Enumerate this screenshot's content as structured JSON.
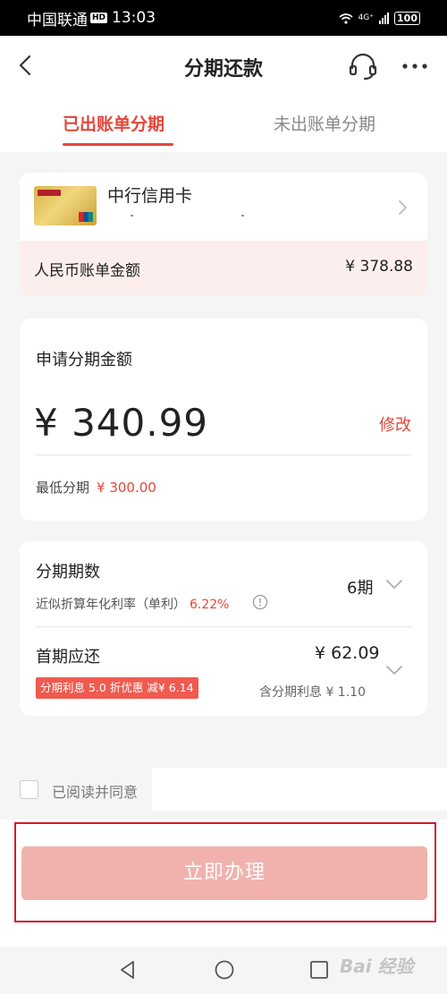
{
  "status_bar": {
    "carrier": "中国联通",
    "hd_badge": "HD",
    "time": "13:03",
    "network": "4G⁺",
    "battery": "100"
  },
  "nav": {
    "title": "分期还款"
  },
  "tabs": [
    {
      "label": "已出账单分期",
      "active": true
    },
    {
      "label": "未出账单分期",
      "active": false
    }
  ],
  "card": {
    "name": "中行信用卡",
    "bill_label": "人民币账单金额",
    "bill_amount": "¥ 378.88"
  },
  "apply": {
    "label": "申请分期金额",
    "amount": "¥ 340.99",
    "modify_label": "修改",
    "min_label": "最低分期",
    "min_amount": "¥ 300.00"
  },
  "installment": {
    "periods_label": "分期期数",
    "rate_label": "近似折算年化利率（单利）",
    "rate_value": "6.22%",
    "periods_value": "6期",
    "first_label": "首期应还",
    "first_amount": "¥ 62.09",
    "promo": "分期利息 5.0 折优惠 减¥ 6.14",
    "interest_note": "含分期利息 ¥ 1.10"
  },
  "agreement": {
    "text": "已阅读并同意"
  },
  "submit_label": "立即办理",
  "watermark": "Bai 经验",
  "colors": {
    "accent": "#e2473a",
    "button_disabled": "#f1b2ad",
    "bill_row_bg": "#fdeeee",
    "highlight_border": "#d4182e"
  }
}
